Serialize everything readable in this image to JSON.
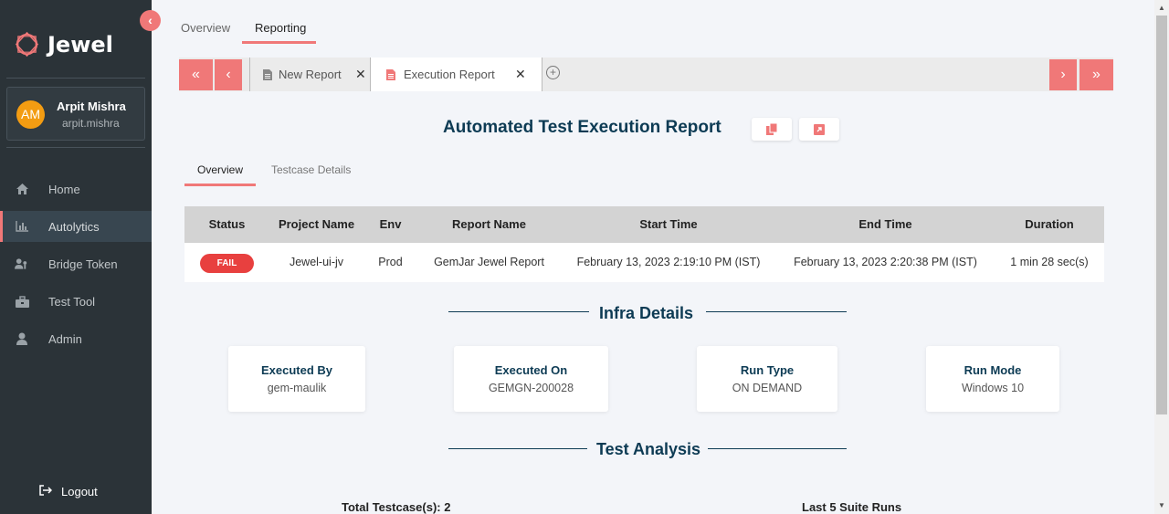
{
  "app": {
    "name": "Jewel"
  },
  "user": {
    "initials": "AM",
    "name": "Arpit Mishra",
    "handle": "arpit.mishra"
  },
  "sidebar": {
    "items": [
      {
        "label": "Home",
        "icon": "home-icon"
      },
      {
        "label": "Autolytics",
        "icon": "bar-chart-icon",
        "active": true
      },
      {
        "label": "Bridge Token",
        "icon": "users-key-icon"
      },
      {
        "label": "Test Tool",
        "icon": "toolbox-icon"
      },
      {
        "label": "Admin",
        "icon": "user-icon"
      }
    ],
    "logout_label": "Logout"
  },
  "top_tabs": [
    {
      "label": "Overview"
    },
    {
      "label": "Reporting",
      "active": true
    }
  ],
  "report_tabs": [
    {
      "label": "New Report",
      "close": "✕"
    },
    {
      "label": "Execution Report",
      "close": "✕",
      "active": true
    }
  ],
  "report": {
    "title": "Automated Test Execution Report",
    "sub_tabs": [
      {
        "label": "Overview",
        "active": true
      },
      {
        "label": "Testcase Details"
      }
    ]
  },
  "table": {
    "headers": [
      "Status",
      "Project Name",
      "Env",
      "Report Name",
      "Start Time",
      "End Time",
      "Duration"
    ],
    "row": {
      "status": "FAIL",
      "project": "Jewel-ui-jv",
      "env": "Prod",
      "report_name": "GemJar Jewel Report",
      "start_time": "February 13, 2023 2:19:10 PM (IST)",
      "end_time": "February 13, 2023 2:20:38 PM (IST)",
      "duration": "1 min 28 sec(s)"
    }
  },
  "infra": {
    "title": "Infra Details",
    "cards": [
      {
        "label": "Executed By",
        "value": "gem-maulik"
      },
      {
        "label": "Executed On",
        "value": "GEMGN-200028"
      },
      {
        "label": "Run Type",
        "value": "ON DEMAND"
      },
      {
        "label": "Run Mode",
        "value": "Windows 10"
      }
    ]
  },
  "analysis": {
    "title": "Test Analysis",
    "total_testcases": "Total Testcase(s): 2",
    "last_runs": "Last 5 Suite Runs"
  },
  "colors": {
    "accent": "#f07878",
    "sidebar_bg": "#2b3338",
    "heading": "#0d3b54",
    "fail": "#e8403f"
  }
}
